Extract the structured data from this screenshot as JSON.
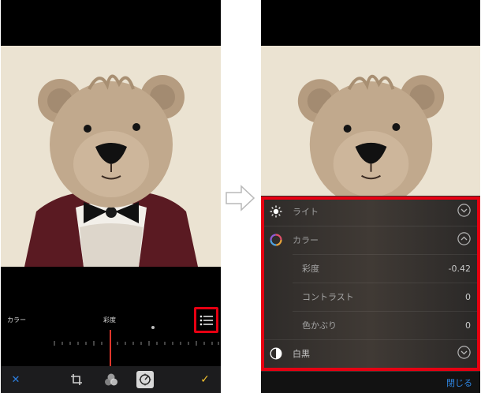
{
  "left_screen": {
    "param_label": "カラー",
    "current_param": "彩度",
    "toolbar": {
      "cancel_icon": "close-icon",
      "crop_icon": "crop-icon",
      "filters_icon": "filters-icon",
      "adjust_icon": "adjust-icon",
      "done_icon": "checkmark-icon"
    },
    "list_button_icon": "list-icon",
    "highlight_color": "#e60012"
  },
  "right_screen": {
    "sections": [
      {
        "label": "ライト",
        "icon": "sun-icon",
        "expanded": false
      },
      {
        "label": "カラー",
        "icon": "color-wheel-icon",
        "expanded": true
      },
      {
        "label": "白黒",
        "icon": "half-circle-icon",
        "expanded": false
      }
    ],
    "color_params": [
      {
        "label": "彩度",
        "value": "-0.42"
      },
      {
        "label": "コントラスト",
        "value": "0"
      },
      {
        "label": "色かぶり",
        "value": "0"
      }
    ],
    "close_label": "閉じる",
    "accent_color": "#2f86e3",
    "highlight_color": "#e60012"
  }
}
